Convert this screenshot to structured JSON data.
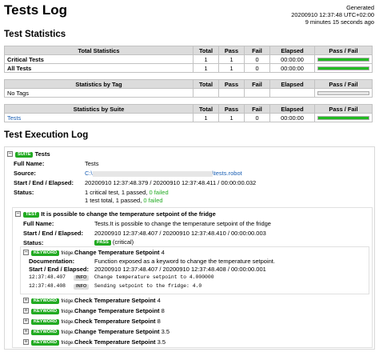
{
  "header": {
    "title": "Tests Log",
    "generated_label": "Generated",
    "generated_time": "20200910 12:37:48 UTC+02:00",
    "ago": "9 minutes 15 seconds ago"
  },
  "colors": {
    "pass": "#22bb22",
    "header_bg": "#dcdcdc",
    "link": "#1a5fb4"
  },
  "statistics": {
    "title": "Test Statistics",
    "columns": [
      "Total",
      "Pass",
      "Fail",
      "Elapsed",
      "Pass / Fail"
    ],
    "total": {
      "heading": "Total Statistics",
      "rows": [
        {
          "name": "Critical Tests",
          "total": "1",
          "pass": "1",
          "fail": "0",
          "elapsed": "00:00:00",
          "pass_ratio": 1
        },
        {
          "name": "All Tests",
          "total": "1",
          "pass": "1",
          "fail": "0",
          "elapsed": "00:00:00",
          "pass_ratio": 1
        }
      ]
    },
    "tag": {
      "heading": "Statistics by Tag",
      "empty": "No Tags"
    },
    "suite": {
      "heading": "Statistics by Suite",
      "rows": [
        {
          "name": "Tests",
          "total": "1",
          "pass": "1",
          "fail": "0",
          "elapsed": "00:00:00",
          "pass_ratio": 1
        }
      ]
    }
  },
  "log": {
    "title": "Test Execution Log",
    "suite": {
      "toggle": "−",
      "label": "SUITE",
      "name": "Tests",
      "full_name_key": "Full Name:",
      "full_name": "Tests",
      "source_key": "Source:",
      "source_prefix": "C:\\",
      "source_suffix": "\\tests.robot",
      "times_key": "Start / End / Elapsed:",
      "times": "20200910 12:37:48.379 / 20200910 12:37:48.411 / 00:00:00.032",
      "status_key": "Status:",
      "status_line1_text": "1 critical test, 1 passed, ",
      "status_line1_fail": "0 failed",
      "status_line2_text": "1 test total, 1 passed, ",
      "status_line2_fail": "0 failed"
    },
    "test": {
      "toggle": "−",
      "label": "TEST",
      "name": "It is possible to change the temperature setpoint of the fridge",
      "full_name_key": "Full Name:",
      "full_name": "Tests.It is possible to change the temperature setpoint of the fridge",
      "times_key": "Start / End / Elapsed:",
      "times": "20200910 12:37:48.407 / 20200910 12:37:48.410 / 00:00:00.003",
      "status_key": "Status:",
      "status_badge": "PASS",
      "status_note": "(critical)"
    },
    "expanded_keyword": {
      "toggle": "−",
      "label": "KEYWORD",
      "lib": "fridge.",
      "name": "Change Temperature Setpoint",
      "arg": "4",
      "doc_key": "Documentation:",
      "doc": "Function exposed as a keyword to change the temperature setpoint.",
      "times_key": "Start / End / Elapsed:",
      "times": "20200910 12:37:48.407 / 20200910 12:37:48.408 / 00:00:00.001",
      "messages": [
        {
          "time": "12:37:48.407",
          "level": "INFO",
          "text": "Change temperature setpoint to 4.000000"
        },
        {
          "time": "12:37:48.408",
          "level": "INFO",
          "text": "Sending setpoint to the fridge:  4.0"
        }
      ]
    },
    "keywords": [
      {
        "toggle": "+",
        "label": "KEYWORD",
        "lib": "fridge.",
        "name": "Check Temperature Setpoint",
        "arg": "4"
      },
      {
        "toggle": "+",
        "label": "KEYWORD",
        "lib": "fridge.",
        "name": "Change Temperature Setpoint",
        "arg": "8"
      },
      {
        "toggle": "+",
        "label": "KEYWORD",
        "lib": "fridge.",
        "name": "Check Temperature Setpoint",
        "arg": "8"
      },
      {
        "toggle": "+",
        "label": "KEYWORD",
        "lib": "fridge.",
        "name": "Change Temperature Setpoint",
        "arg": "3.5"
      },
      {
        "toggle": "+",
        "label": "KEYWORD",
        "lib": "fridge.",
        "name": "Check Temperature Setpoint",
        "arg": "3.5"
      }
    ]
  }
}
